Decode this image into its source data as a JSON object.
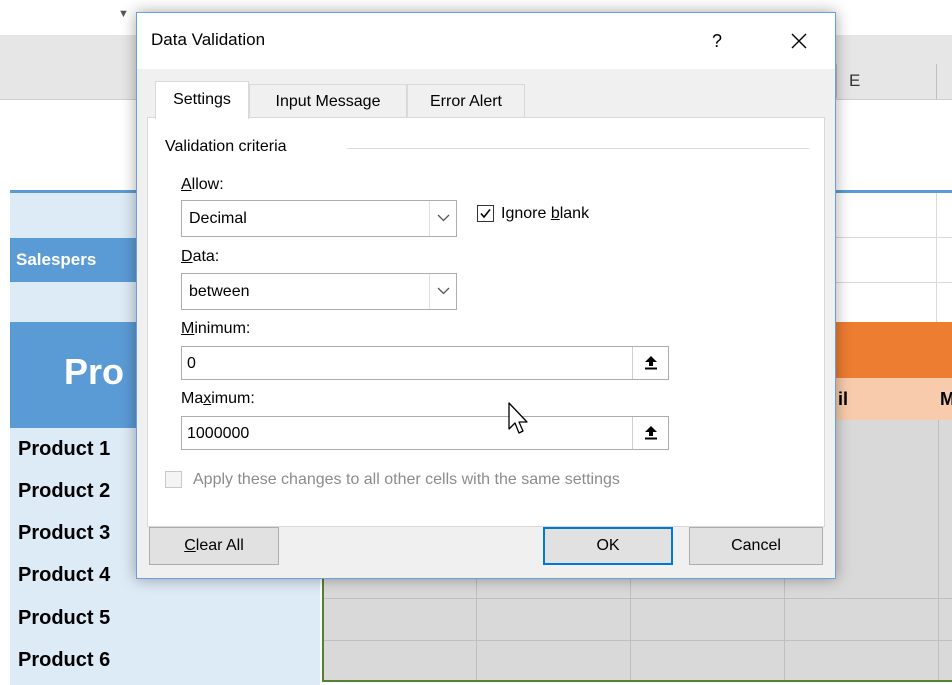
{
  "sheet": {
    "column_e_label": "E",
    "salesperson_text": "Salespers",
    "pro_text": "Pro",
    "peach_text_left": "il",
    "peach_text_right": "M",
    "products": [
      "Product 1",
      "Product 2",
      "Product 3",
      "Product 4",
      "Product 5",
      "Product 6"
    ]
  },
  "dialog": {
    "title": "Data Validation",
    "help_label": "?",
    "close_label": "✕",
    "tabs": [
      {
        "label": "Settings",
        "active": true
      },
      {
        "label": "Input Message",
        "active": false
      },
      {
        "label": "Error Alert",
        "active": false
      }
    ],
    "criteria_group_label": "Validation criteria",
    "allow": {
      "label_first": "A",
      "label_rest": "llow:",
      "value": "Decimal"
    },
    "ignore_blank": {
      "checked": true,
      "label_before": "Ignore ",
      "label_key": "b",
      "label_after": "lank"
    },
    "data": {
      "label_first": "D",
      "label_rest": "ata:",
      "value": "between"
    },
    "minimum": {
      "label_first": "M",
      "label_rest": "inimum:",
      "value": "0"
    },
    "maximum": {
      "label_before": "Ma",
      "label_key": "x",
      "label_after": "imum:",
      "value": "1000000"
    },
    "apply_all": {
      "checked": false,
      "label": "Apply these changes to all other cells with the same settings"
    },
    "buttons": {
      "clear_all_first": "C",
      "clear_all_rest": "lear All",
      "ok": "OK",
      "cancel": "Cancel"
    }
  },
  "colors": {
    "accent_blue": "#5b9bd5",
    "orange": "#ed7d31",
    "peach": "#f8cbad",
    "default_button_border": "#0078d7"
  }
}
